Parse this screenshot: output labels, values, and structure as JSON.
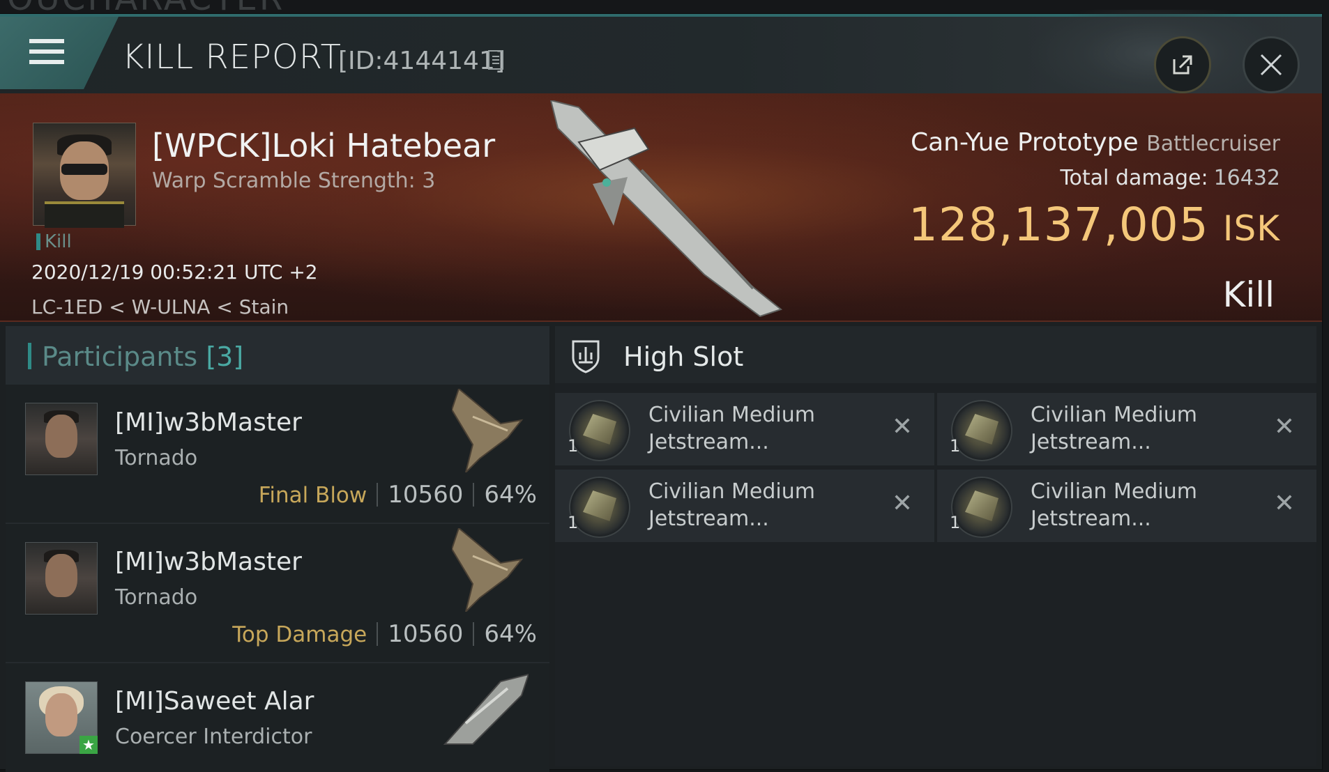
{
  "window": {
    "title": "KILL REPORT",
    "report_id": "[ID:4144141]",
    "ghost_title": "OUCHARACTER"
  },
  "victim": {
    "name": "[WPCK]Loki Hatebear",
    "scramble": "Warp Scramble Strength: 3",
    "kill_tag": "Kill",
    "datetime": "2020/12/19 00:52:21 UTC +2",
    "location": "LC-1ED < W-ULNA < Stain",
    "ship_name": "Can-Yue Prototype",
    "ship_class": "Battlecruiser",
    "total_damage_label": "Total damage:",
    "total_damage": "16432",
    "isk_value": "128,137,005",
    "isk_unit": "ISK",
    "result": "Kill"
  },
  "participants": {
    "label": "Participants",
    "count": "[3]",
    "rows": [
      {
        "name": "[MI]w3bMaster",
        "ship": "Tornado",
        "role": "Final Blow",
        "damage": "10560",
        "percent": "64%"
      },
      {
        "name": "[MI]w3bMaster",
        "ship": "Tornado",
        "role": "Top Damage",
        "damage": "10560",
        "percent": "64%"
      },
      {
        "name": "[MI]Saweet Alar",
        "ship": "Coercer Interdictor"
      }
    ]
  },
  "high_slot": {
    "label": "High Slot",
    "items": [
      {
        "qty": "1",
        "line1": "Civilian Medium",
        "line2": "Jetstream..."
      },
      {
        "qty": "1",
        "line1": "Civilian Medium",
        "line2": "Jetstream..."
      },
      {
        "qty": "1",
        "line1": "Civilian Medium",
        "line2": "Jetstream..."
      },
      {
        "qty": "1",
        "line1": "Civilian Medium",
        "line2": "Jetstream..."
      }
    ]
  },
  "icons": {
    "menu": "hamburger-icon",
    "copy": "copy-icon",
    "share": "external-link-icon",
    "close": "close-icon",
    "slot": "shield-icon",
    "remove": "x-icon"
  },
  "colors": {
    "accent": "#2f8b87",
    "isk": "#f4c77a",
    "role": "#c7a75a"
  }
}
